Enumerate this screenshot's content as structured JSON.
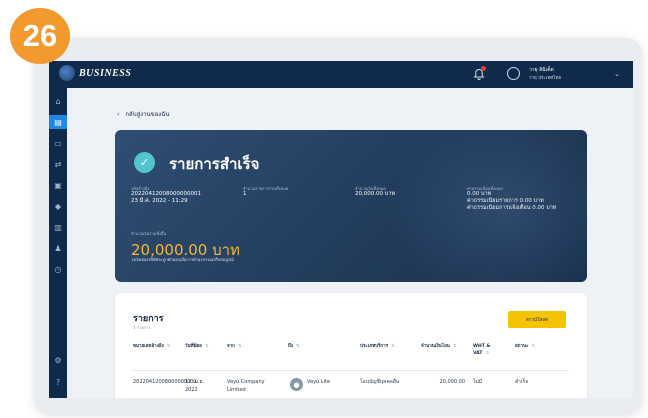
{
  "step_badge": "26",
  "topbar": {
    "logo_text": "BUSINESS",
    "logo_small": "K",
    "user_name": "วายุ ลิมิเต็ด",
    "user_company": "วายุ ประเทศไทย"
  },
  "sidebar": {
    "items": [
      {
        "icon": "home-icon",
        "glyph": "⌂"
      },
      {
        "icon": "document-icon",
        "glyph": "▤",
        "active": true
      },
      {
        "icon": "card-icon",
        "glyph": "▭"
      },
      {
        "icon": "transfer-icon",
        "glyph": "⇄"
      },
      {
        "icon": "wallet-icon",
        "glyph": "▣"
      },
      {
        "icon": "tag-icon",
        "glyph": "◆"
      },
      {
        "icon": "report-icon",
        "glyph": "▥"
      },
      {
        "icon": "users-icon",
        "glyph": "♟"
      },
      {
        "icon": "clock-icon",
        "glyph": "◷"
      },
      {
        "icon": "settings-icon",
        "glyph": "⚙"
      },
      {
        "icon": "help-icon",
        "glyph": "?"
      }
    ]
  },
  "back_link": "กลับสู่งานของฉัน",
  "hero": {
    "title": "รายการสำเร็จ",
    "ref_label": "รหัสอ้างอิง",
    "ref_value": "20220412008000000001",
    "ref_date": "23 มี.ค. 2022 - 11:29",
    "count_label": "จำนวนรายการรวมทั้งหมด",
    "count_value": "1",
    "amount_label": "จำนวนเงินทั้งหมด",
    "amount_value": "20,000.00 บาท",
    "fee_label": "ค่าธรรมเนียมทั้งหมด",
    "fee_value": "0.00 บาท",
    "fee_line2": "ค่าธรรมเนียมรายการ 0.00 บาท",
    "fee_line3": "ค่าธรรมเนียมการแจ้งเตือน 0.00 บาท",
    "total_label": "จำนวนเงินรวมทั้งสิ้น",
    "total_value": "20,000.00 บาท",
    "total_note": "วงเงินของบริษัทจะถูกหักออกเมื่อการทำธุรกรรมเสร็จสมบูรณ์"
  },
  "panel": {
    "title": "รายการ",
    "count": "1 รายการ",
    "download_label": "ดาวน์โหลด",
    "headers": [
      "หมายเลขอ้างอิง",
      "วันที่มีผล",
      "จาก",
      "ถึง",
      "ประเภทบริการ",
      "จำนวนเงินโอน",
      "WHT & VAT",
      "สถานะ"
    ],
    "row": {
      "ref": "20220412008000000001",
      "date": "12 เม.ย. 2022",
      "from": "Vayu Company Limited",
      "to": "Vayu Lite",
      "service": "โอนบัญชีบุคคลอื่น",
      "amount": "20,000.00",
      "wht": "ไม่มี",
      "status": "สำเร็จ"
    }
  },
  "colors": {
    "navy": "#0f2a4a",
    "accent_blue": "#1e88e5",
    "badge_orange": "#f29a2e",
    "success_teal": "#52c4cf",
    "amount_gold": "#f5b82e",
    "button_yellow": "#f5c400"
  }
}
